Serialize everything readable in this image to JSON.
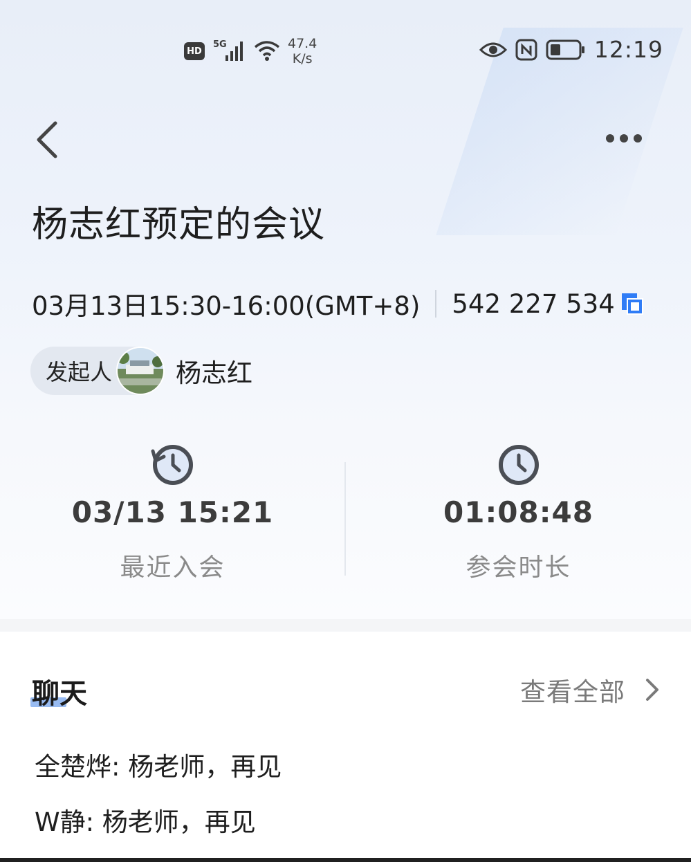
{
  "status_bar": {
    "hd": "HD",
    "network": "5G",
    "speed_value": "47.4",
    "speed_unit": "K/s",
    "time": "12:19",
    "icons": [
      "signal-icon",
      "wifi-icon",
      "eye-icon",
      "nfc-icon",
      "battery-icon"
    ]
  },
  "header": {
    "back_icon": "chevron-left-icon",
    "more_icon": "more-horizontal-icon"
  },
  "meeting": {
    "title": "杨志红预定的会议",
    "time_range": "03月13日15:30-16:00(GMT+8)",
    "meeting_id": "542 227 534",
    "organizer_label": "发起人",
    "organizer_name": "杨志红"
  },
  "stats": {
    "recent_join_value": "03/13 15:21",
    "recent_join_label": "最近入会",
    "duration_value": "01:08:48",
    "duration_label": "参会时长"
  },
  "chat": {
    "title": "聊天",
    "view_all": "查看全部",
    "messages": [
      {
        "text": "全楚烨: 杨老师，再见"
      },
      {
        "text": "W静: 杨老师，再见"
      }
    ]
  },
  "colors": {
    "accent": "#2f7cf6",
    "icon_dark": "#4a4e55",
    "icon_face": "#dfe8f7"
  }
}
